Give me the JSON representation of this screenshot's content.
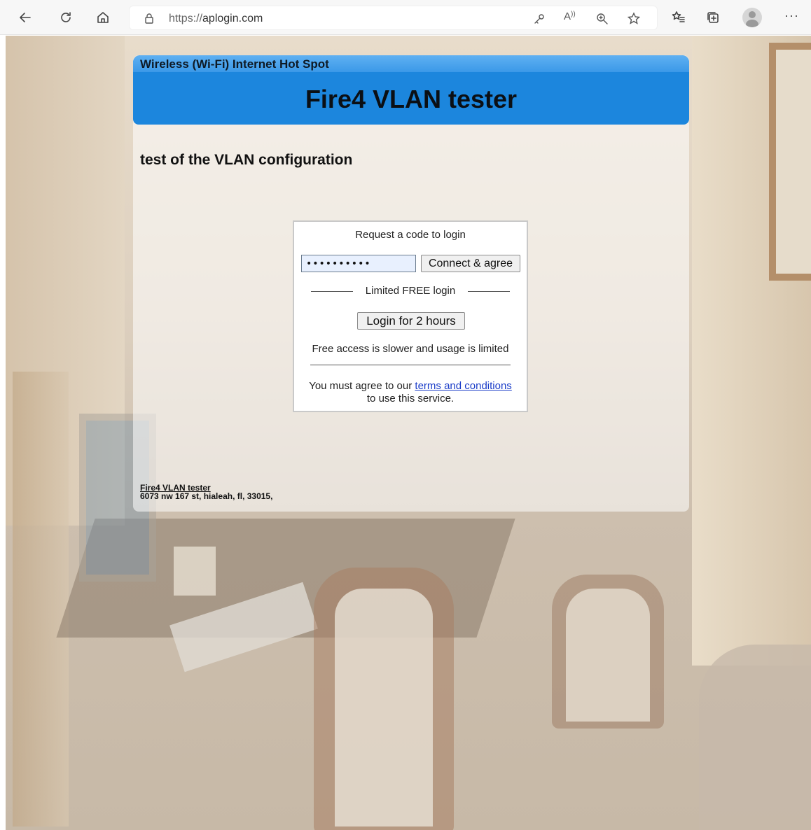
{
  "browser": {
    "url_protocol": "https://",
    "url_host": "aplogin.com",
    "toolbar_icons": [
      "back-icon",
      "refresh-icon",
      "home-icon",
      "lock-icon",
      "key-icon",
      "read-aloud-icon",
      "zoom-icon",
      "favorite-add-icon",
      "favorites-icon",
      "collections-icon",
      "profile-icon",
      "more-icon"
    ],
    "read_aloud_label": "A",
    "more_label": "···"
  },
  "portal": {
    "hotspot_label": "Wireless (Wi-Fi) Internet Hot Spot",
    "title": "Fire4 VLAN tester",
    "subtitle": "test of the VLAN configuration",
    "header_color": "#1c86dd"
  },
  "login": {
    "request_text": "Request a code to login",
    "code_value": "••••••••••",
    "connect_label": "Connect & agree",
    "free_divider_label": "Limited FREE login",
    "free_button_label": "Login for 2 hours",
    "free_note": "Free access is slower and usage is limited",
    "terms_prefix": "You must agree to our",
    "terms_link": "terms and conditions",
    "terms_suffix": "to use this service."
  },
  "footer": {
    "name": "Fire4 VLAN tester",
    "address": "6073 nw 167 st, hialeah, fl, 33015,"
  }
}
